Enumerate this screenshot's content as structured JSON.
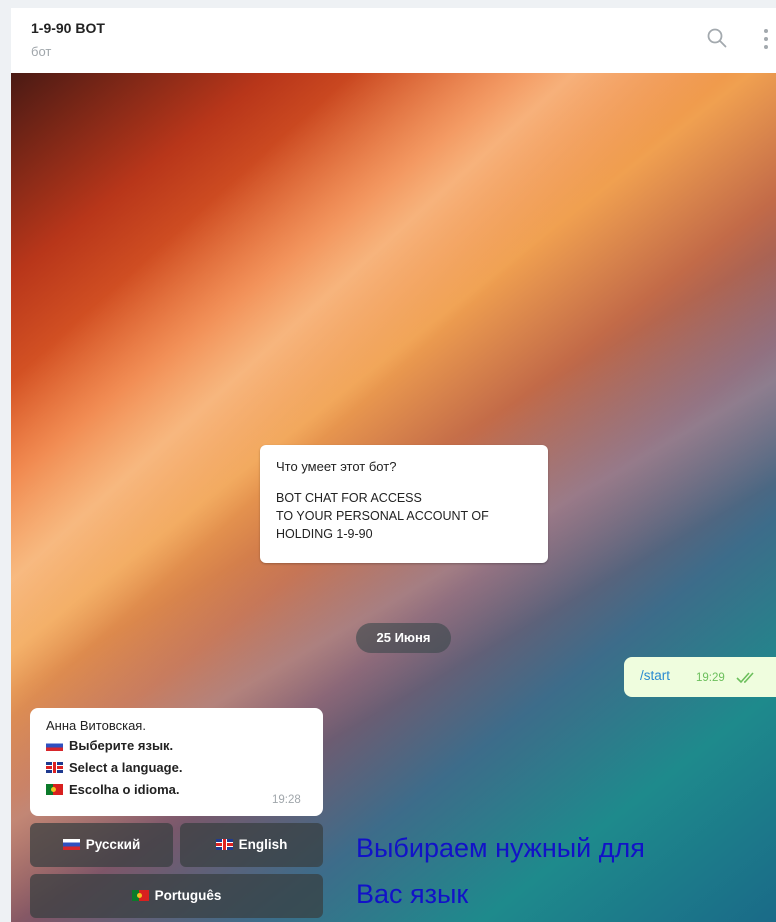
{
  "header": {
    "title": "1-9-90 BOT",
    "subtitle": "бот",
    "search_icon": "search-icon",
    "more_icon": "more-vertical-icon"
  },
  "info_card": {
    "question": "Что умеет этот бот?",
    "lines": [
      "BOT CHAT FOR ACCESS",
      "TO YOUR PERSONAL ACCOUNT OF",
      "HOLDING 1-9-90"
    ]
  },
  "date_divider": "25 Июня",
  "outgoing": {
    "text": "/start",
    "time": "19:29",
    "status_icon": "double-check-icon",
    "status_color": "#6cbf5c"
  },
  "incoming": {
    "sender": "Анна Витовская.",
    "lines": [
      "Выберите язык.",
      "Select a language.",
      "Escolha o idioma."
    ],
    "time": "19:28"
  },
  "keyboard": {
    "russian": "Русский",
    "english": "English",
    "portuguese": "Português"
  },
  "annotation": {
    "line1": "Выбираем нужный для",
    "line2": "Вас язык",
    "color": "#1212c8"
  }
}
